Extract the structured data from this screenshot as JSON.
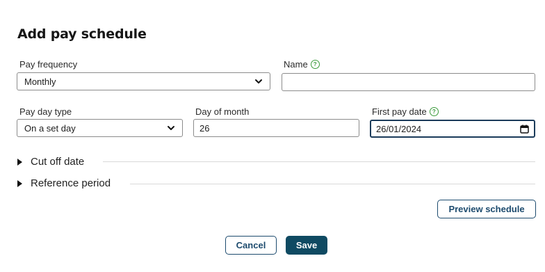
{
  "dialog": {
    "title": "Add pay schedule"
  },
  "form": {
    "pay_frequency": {
      "label": "Pay frequency",
      "value": "Monthly"
    },
    "name": {
      "label": "Name",
      "value": ""
    },
    "pay_day_type": {
      "label": "Pay day type",
      "value": "On a set day"
    },
    "day_of_month": {
      "label": "Day of month",
      "value": "26"
    },
    "first_pay_date": {
      "label": "First pay date",
      "value": "26/01/2024"
    }
  },
  "sections": {
    "cut_off_date": "Cut off date",
    "reference_period": "Reference period"
  },
  "buttons": {
    "preview": "Preview schedule",
    "cancel": "Cancel",
    "save": "Save"
  },
  "icons": {
    "help": "?",
    "help_icon_name": "help-circle-icon",
    "chevron_icon_name": "chevron-down-icon",
    "calendar_icon_name": "calendar-icon",
    "expand_icon_name": "caret-right-icon"
  },
  "colors": {
    "help_green": "#3a9a3a",
    "primary_button": "#0f4a62",
    "outline_button": "#1d4b6e",
    "focused_border": "#1b3b5a"
  }
}
